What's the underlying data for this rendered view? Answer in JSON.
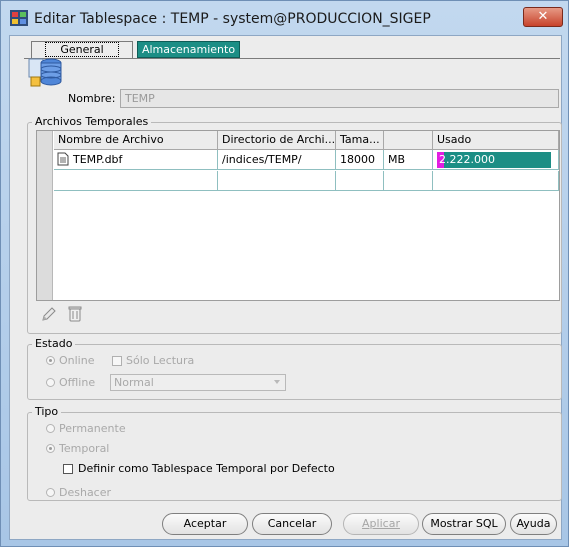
{
  "window": {
    "title": "Editar Tablespace : TEMP - system@PRODUCCION_SIGEP",
    "close_glyph": "✕"
  },
  "tabs": [
    {
      "label": "General",
      "active": true
    },
    {
      "label": "Almacenamiento",
      "active": false
    }
  ],
  "nombre": {
    "label": "Nombre:",
    "value": "TEMP"
  },
  "archivos": {
    "group_label": "Archivos Temporales",
    "columns": [
      "Nombre de Archivo",
      "Directorio de Archi...",
      "Tama...",
      "",
      "Usado"
    ],
    "rows": [
      {
        "file": "TEMP.dbf",
        "dir": "/indices/TEMP/",
        "size": "18000",
        "unit": "MB",
        "usado": "2.222.000",
        "usado_fraction": 0.06
      }
    ],
    "tools": [
      "pencil-icon",
      "trash-icon"
    ]
  },
  "estado": {
    "group_label": "Estado",
    "online_label": "Online",
    "readonly_label": "Sólo Lectura",
    "offline_label": "Offline",
    "offline_select": "Normal"
  },
  "tipo": {
    "group_label": "Tipo",
    "permanente_label": "Permanente",
    "temporal_label": "Temporal",
    "default_temp_label": "Definir como Tablespace Temporal por Defecto",
    "deshacer_label": "Deshacer"
  },
  "buttons": {
    "aceptar": "Aceptar",
    "cancelar": "Cancelar",
    "aplicar": "Aplicar",
    "mostrar_sql": "Mostrar SQL",
    "ayuda": "Ayuda"
  },
  "colors": {
    "accent": "#1c8e85",
    "usage_fill": "#e21ee2"
  }
}
